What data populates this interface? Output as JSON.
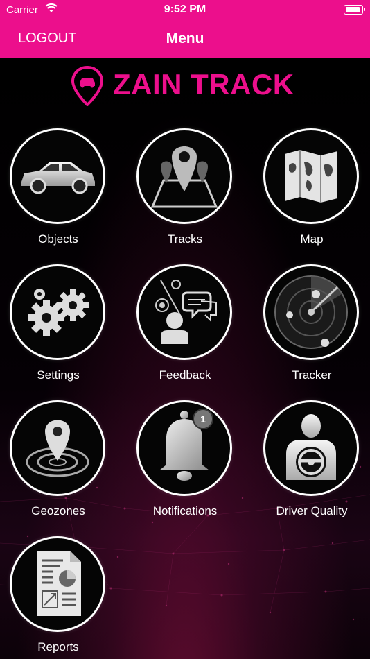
{
  "status_bar": {
    "carrier": "Carrier",
    "time": "9:52 PM"
  },
  "nav": {
    "logout_label": "LOGOUT",
    "title": "Menu"
  },
  "brand": {
    "name": "ZAIN TRACK",
    "color": "#ec0f8c"
  },
  "menu": [
    {
      "label": "Objects",
      "icon": "car-icon"
    },
    {
      "label": "Tracks",
      "icon": "location-pins-icon"
    },
    {
      "label": "Map",
      "icon": "folded-map-icon"
    },
    {
      "label": "Settings",
      "icon": "gears-icon"
    },
    {
      "label": "Feedback",
      "icon": "feedback-icon"
    },
    {
      "label": "Tracker",
      "icon": "radar-icon"
    },
    {
      "label": "Geozones",
      "icon": "geozone-pin-icon"
    },
    {
      "label": "Notifications",
      "icon": "bell-icon",
      "badge": "1"
    },
    {
      "label": "Driver Quality",
      "icon": "driver-icon"
    },
    {
      "label": "Reports",
      "icon": "report-document-icon"
    }
  ]
}
